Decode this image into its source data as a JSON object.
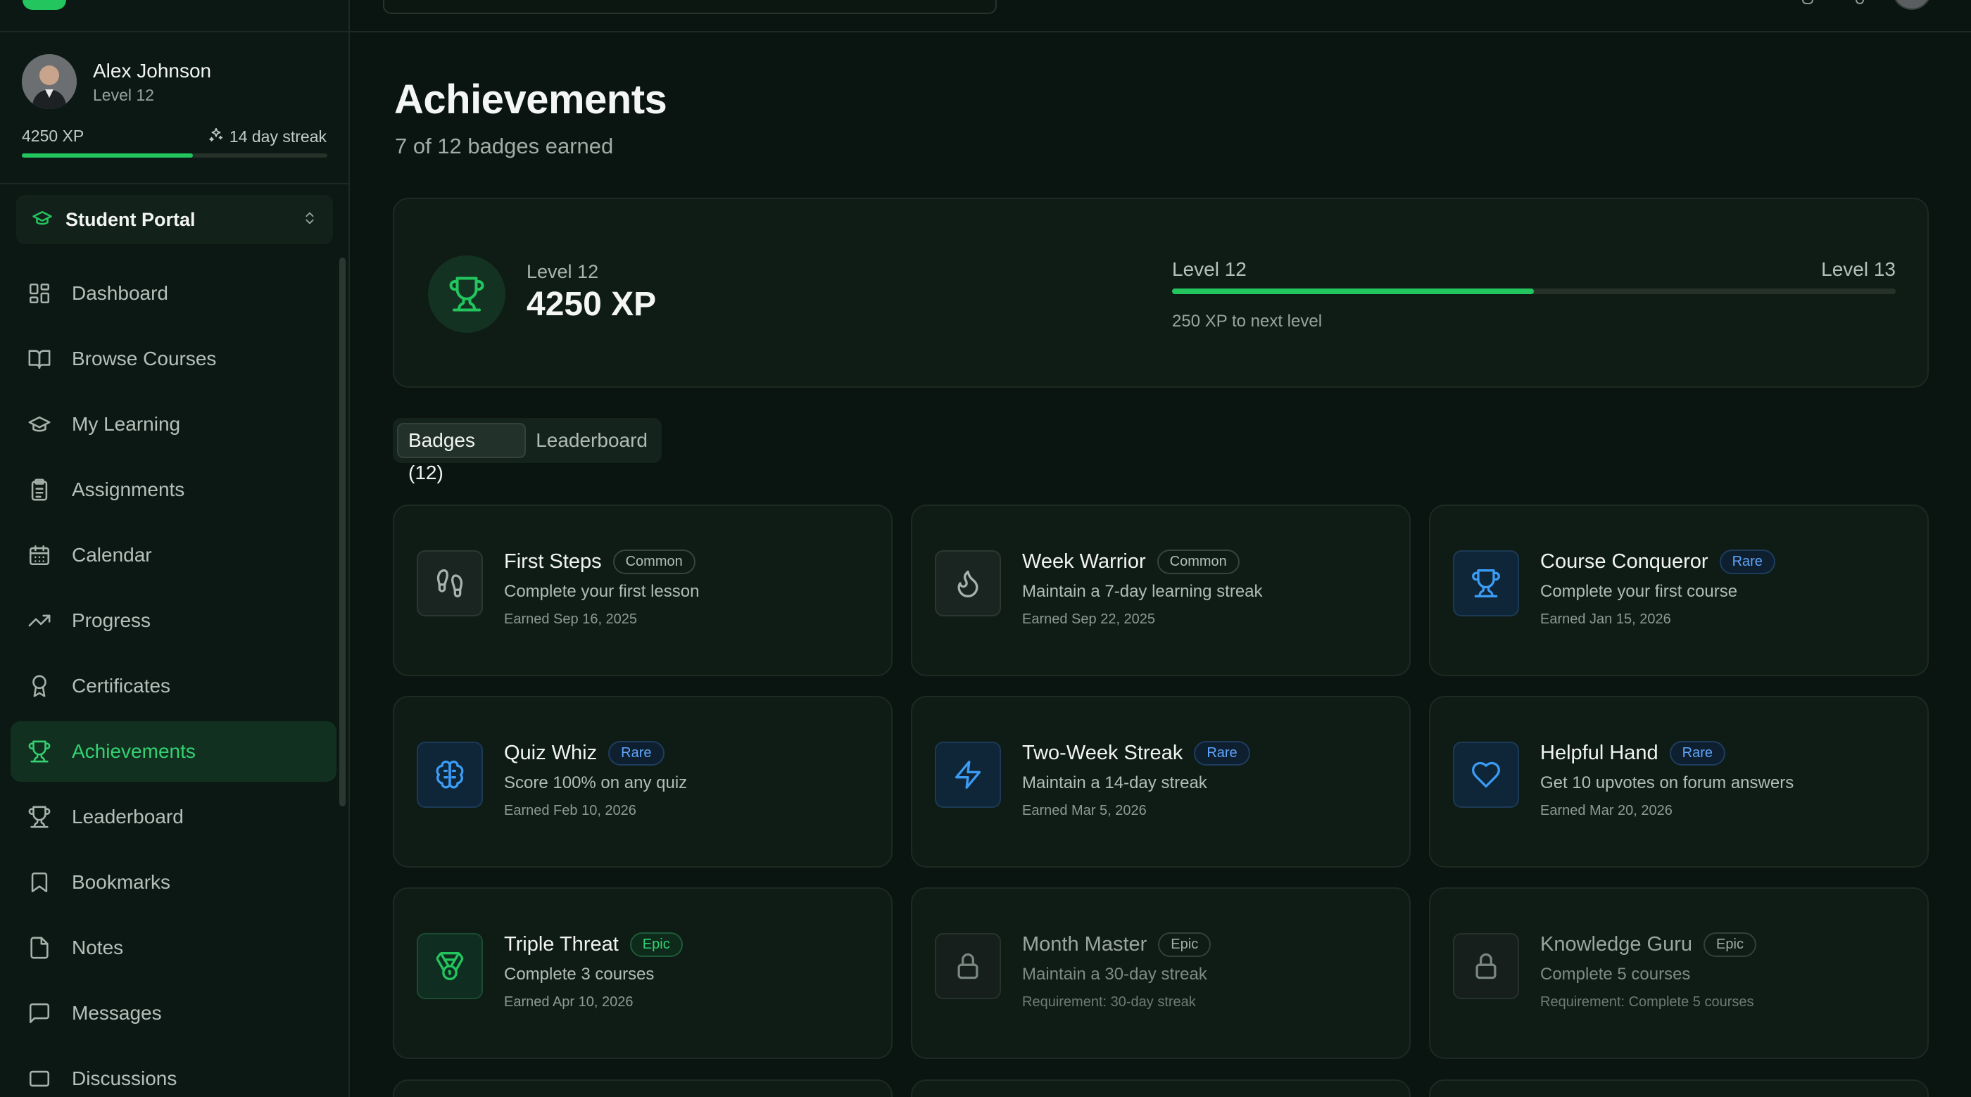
{
  "user": {
    "name": "Alex Johnson",
    "level": "Level 12",
    "xp": "4250 XP",
    "streak": "14 day streak",
    "xp_progress": 0.56
  },
  "portal": {
    "label": "Student Portal"
  },
  "nav": [
    {
      "label": "Dashboard",
      "icon": "dashboard-icon"
    },
    {
      "label": "Browse Courses",
      "icon": "book-open-icon"
    },
    {
      "label": "My Learning",
      "icon": "graduation-cap-icon"
    },
    {
      "label": "Assignments",
      "icon": "clipboard-icon"
    },
    {
      "label": "Calendar",
      "icon": "calendar-icon"
    },
    {
      "label": "Progress",
      "icon": "trending-up-icon"
    },
    {
      "label": "Certificates",
      "icon": "award-icon"
    },
    {
      "label": "Achievements",
      "icon": "trophy-icon",
      "active": true
    },
    {
      "label": "Leaderboard",
      "icon": "trophy-icon"
    },
    {
      "label": "Bookmarks",
      "icon": "bookmark-icon"
    },
    {
      "label": "Notes",
      "icon": "file-icon"
    },
    {
      "label": "Messages",
      "icon": "message-icon"
    },
    {
      "label": "Discussions",
      "icon": "discussion-icon"
    }
  ],
  "page": {
    "title": "Achievements",
    "subtitle": "7 of 12 badges earned"
  },
  "level_card": {
    "level": "Level 12",
    "xp": "4250 XP",
    "from_level": "Level 12",
    "to_level": "Level 13",
    "progress": 0.5,
    "next_text": "250 XP to next level"
  },
  "tabs": [
    {
      "label": "Badges (12)",
      "active": true
    },
    {
      "label": "Leaderboard",
      "active": false
    }
  ],
  "badges": [
    {
      "title": "First Steps",
      "rarity": "Common",
      "tier": "common",
      "desc": "Complete your first lesson",
      "meta": "Earned Sep 16, 2025",
      "icon": "footprints-icon",
      "locked": false
    },
    {
      "title": "Week Warrior",
      "rarity": "Common",
      "tier": "common",
      "desc": "Maintain a 7-day learning streak",
      "meta": "Earned Sep 22, 2025",
      "icon": "flame-icon",
      "locked": false
    },
    {
      "title": "Course Conqueror",
      "rarity": "Rare",
      "tier": "rare",
      "desc": "Complete your first course",
      "meta": "Earned Jan 15, 2026",
      "icon": "trophy-icon",
      "locked": false
    },
    {
      "title": "Quiz Whiz",
      "rarity": "Rare",
      "tier": "rare",
      "desc": "Score 100% on any quiz",
      "meta": "Earned Feb 10, 2026",
      "icon": "brain-icon",
      "locked": false
    },
    {
      "title": "Two-Week Streak",
      "rarity": "Rare",
      "tier": "rare",
      "desc": "Maintain a 14-day streak",
      "meta": "Earned Mar 5, 2026",
      "icon": "lightning-icon",
      "locked": false
    },
    {
      "title": "Helpful Hand",
      "rarity": "Rare",
      "tier": "rare",
      "desc": "Get 10 upvotes on forum answers",
      "meta": "Earned Mar 20, 2026",
      "icon": "heart-icon",
      "locked": false
    },
    {
      "title": "Triple Threat",
      "rarity": "Epic",
      "tier": "epic",
      "desc": "Complete 3 courses",
      "meta": "Earned Apr 10, 2026",
      "icon": "medal-icon",
      "locked": false
    },
    {
      "title": "Month Master",
      "rarity": "Epic",
      "tier": "epic",
      "desc": "Maintain a 30-day streak",
      "meta": "Requirement: 30-day streak",
      "icon": "lock-icon",
      "locked": true
    },
    {
      "title": "Knowledge Guru",
      "rarity": "Epic",
      "tier": "epic",
      "desc": "Complete 5 courses",
      "meta": "Requirement: Complete 5 courses",
      "icon": "lock-icon",
      "locked": true
    }
  ],
  "colors": {
    "accent": "#22c55e",
    "rare": "#60a5fa",
    "background": "#0a1511"
  }
}
